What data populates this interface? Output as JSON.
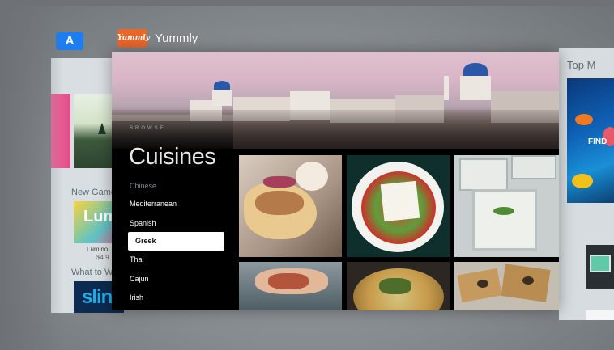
{
  "apps": {
    "appstore_glyph": "A",
    "yummly_glyph": "Yummly",
    "yummly_title": "Yummly"
  },
  "appstore_card": {
    "new_games": "New Game",
    "game_title": "Lumin",
    "game_name": "Lumino",
    "game_price": "$4.9",
    "what_to": "What to W",
    "sling": "slin"
  },
  "right_card": {
    "title": "Top M",
    "poster_title": "FIND"
  },
  "browse": {
    "label": "BROWSE",
    "title": "Cuisines",
    "items": [
      {
        "label": "Chinese",
        "state": "faded"
      },
      {
        "label": "Mediterranean",
        "state": "normal"
      },
      {
        "label": "Spanish",
        "state": "normal"
      },
      {
        "label": "Greek",
        "state": "selected"
      },
      {
        "label": "Thai",
        "state": "normal"
      },
      {
        "label": "Cajun",
        "state": "normal"
      },
      {
        "label": "Irish",
        "state": "normal"
      }
    ]
  },
  "colors": {
    "yummly_brand": "#e8672b",
    "appstore_blue": "#1c7ef0",
    "selection": "#ffffff"
  }
}
